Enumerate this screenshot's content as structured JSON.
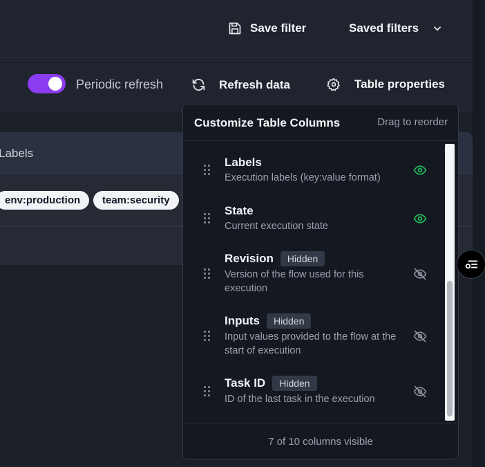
{
  "header": {
    "save_filter": "Save filter",
    "saved_filters": "Saved filters"
  },
  "toolbar": {
    "periodic_refresh": "Periodic refresh",
    "periodic_refresh_on": true,
    "refresh_data": "Refresh data",
    "table_properties": "Table properties"
  },
  "table": {
    "column_header": "Labels",
    "labels": [
      "env:production",
      "team:security"
    ]
  },
  "popover": {
    "title": "Customize Table Columns",
    "hint": "Drag to reorder",
    "hidden_badge": "Hidden",
    "columns": [
      {
        "name": "Labels",
        "description": "Execution labels (key:value format)",
        "hidden": false
      },
      {
        "name": "State",
        "description": "Current execution state",
        "hidden": false
      },
      {
        "name": "Revision",
        "description": "Version of the flow used for this execution",
        "hidden": true
      },
      {
        "name": "Inputs",
        "description": "Input values provided to the flow at the start of execution",
        "hidden": true
      },
      {
        "name": "Task ID",
        "description": "ID of the last task in the execution",
        "hidden": true
      }
    ],
    "footer": "7 of 10 columns visible"
  },
  "colors": {
    "accent": "#8b3cf0",
    "visible_eye": "#22c55e",
    "hidden_eye": "#8a909b"
  }
}
